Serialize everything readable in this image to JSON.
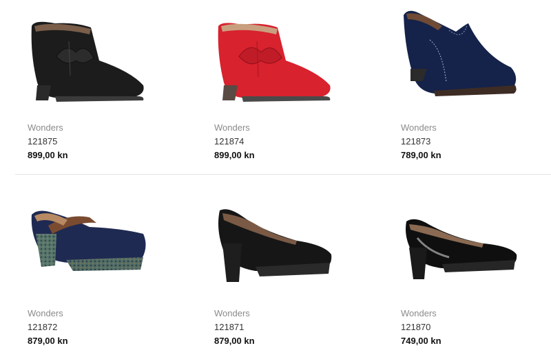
{
  "products": [
    {
      "brand": "Wonders",
      "code": "121875",
      "price": "899,00 kn",
      "image": "black-leather-ankle-boot-bow"
    },
    {
      "brand": "Wonders",
      "code": "121874",
      "price": "899,00 kn",
      "image": "red-leather-ankle-boot-bow"
    },
    {
      "brand": "Wonders",
      "code": "121873",
      "price": "789,00 kn",
      "image": "navy-suede-shootie"
    },
    {
      "brand": "Wonders",
      "code": "121872",
      "price": "879,00 kn",
      "image": "navy-suede-mary-jane-platform"
    },
    {
      "brand": "Wonders",
      "code": "121871",
      "price": "879,00 kn",
      "image": "black-leather-platform-pump"
    },
    {
      "brand": "Wonders",
      "code": "121870",
      "price": "749,00 kn",
      "image": "black-patent-platform-pump"
    }
  ]
}
